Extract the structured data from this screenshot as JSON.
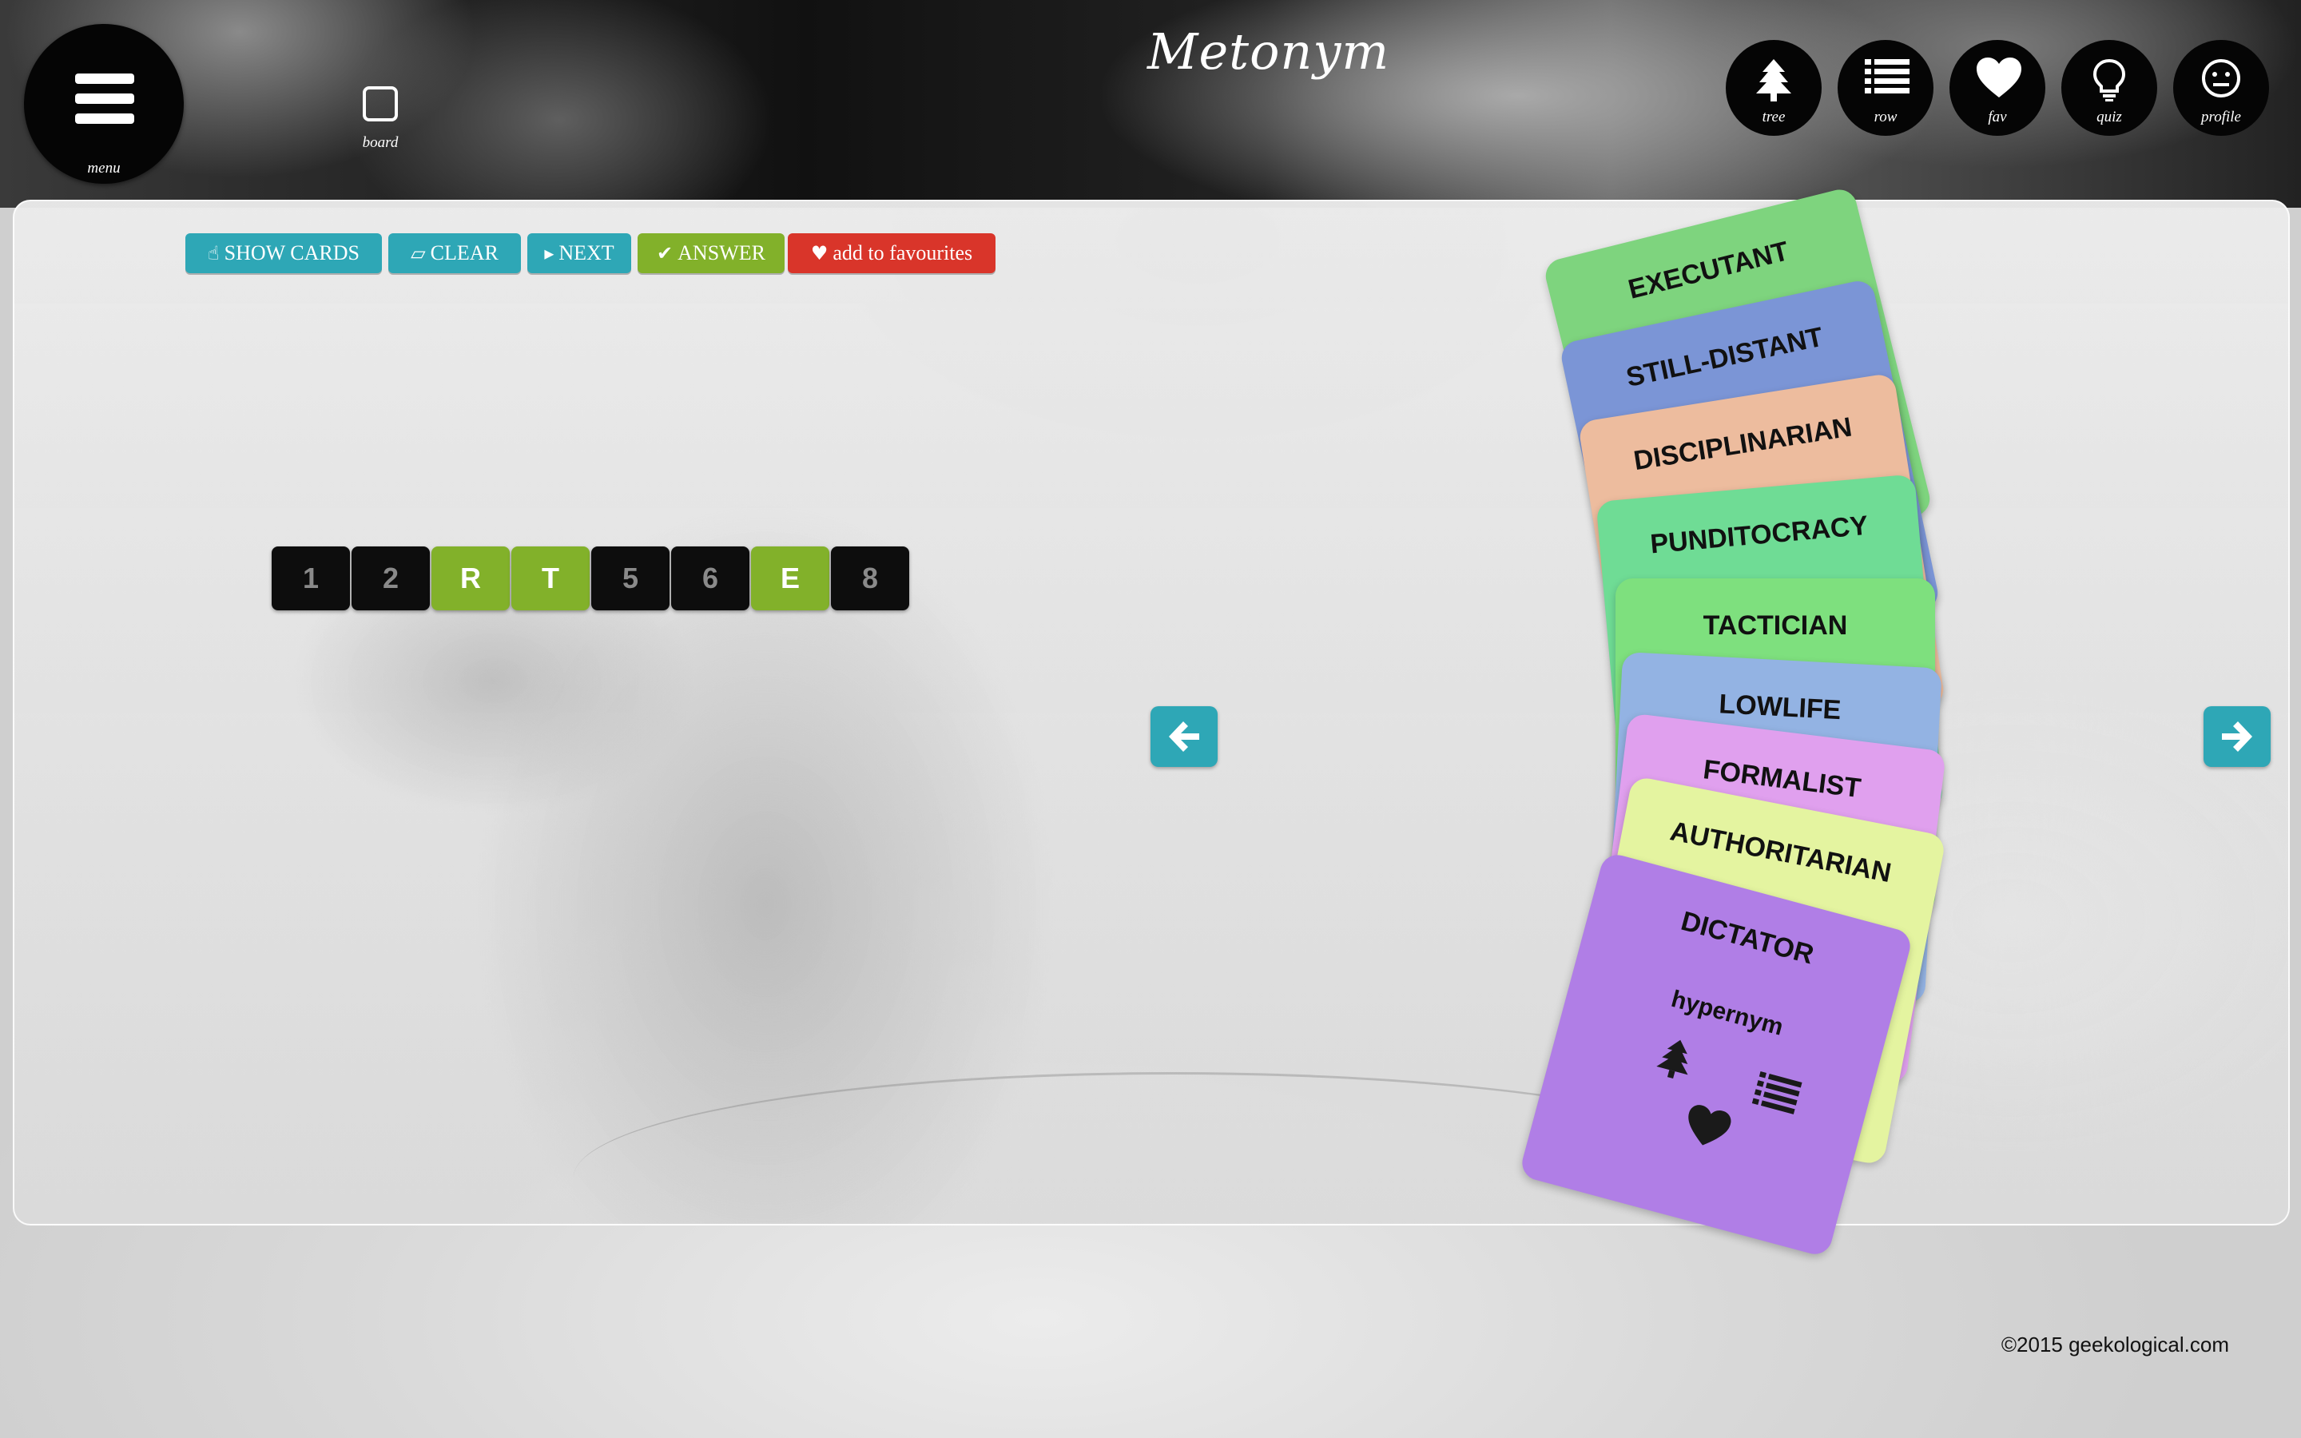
{
  "header": {
    "logo": "Metonym",
    "menu_label": "menu",
    "board_label": "board",
    "nav": [
      {
        "label": "tree",
        "icon": "tree-icon"
      },
      {
        "label": "row",
        "icon": "list-icon"
      },
      {
        "label": "fav",
        "icon": "heart-icon"
      },
      {
        "label": "quiz",
        "icon": "lightbulb-icon"
      },
      {
        "label": "profile",
        "icon": "smiley-icon"
      }
    ]
  },
  "toolbar": {
    "show_cards": "SHOW CARDS",
    "clear": "CLEAR",
    "next": "NEXT",
    "answer": "ANSWER",
    "favourites": "add to favourites"
  },
  "slots": [
    {
      "text": "1",
      "filled": false
    },
    {
      "text": "2",
      "filled": false
    },
    {
      "text": "R",
      "filled": true
    },
    {
      "text": "T",
      "filled": true
    },
    {
      "text": "5",
      "filled": false
    },
    {
      "text": "6",
      "filled": false
    },
    {
      "text": "E",
      "filled": true
    },
    {
      "text": "8",
      "filled": false
    }
  ],
  "cards": [
    {
      "word": "EXECUTANT",
      "color": "#7ed47e"
    },
    {
      "word": "STILL-DISTANT",
      "color": "#7b95d6"
    },
    {
      "word": "DISCIPLINARIAN",
      "color": "#edbc9e"
    },
    {
      "word": "PUNDITOCRACY",
      "color": "#6fdc95"
    },
    {
      "word": "TACTICIAN",
      "color": "#7ee07e"
    },
    {
      "word": "LOWLIFE",
      "color": "#93b3e3"
    },
    {
      "word": "FORMALIST",
      "color": "#e0a0ee"
    },
    {
      "word": "AUTHORITARIAN",
      "color": "#e4f4a0"
    },
    {
      "word": "DICTATOR",
      "color": "#b07ee6",
      "subtitle": "hypernym"
    }
  ],
  "colors": {
    "teal": "#2ea7b6",
    "green": "#82b12a",
    "red": "#d9352a"
  },
  "footer": {
    "copyright": "©2015 geekological.com"
  }
}
